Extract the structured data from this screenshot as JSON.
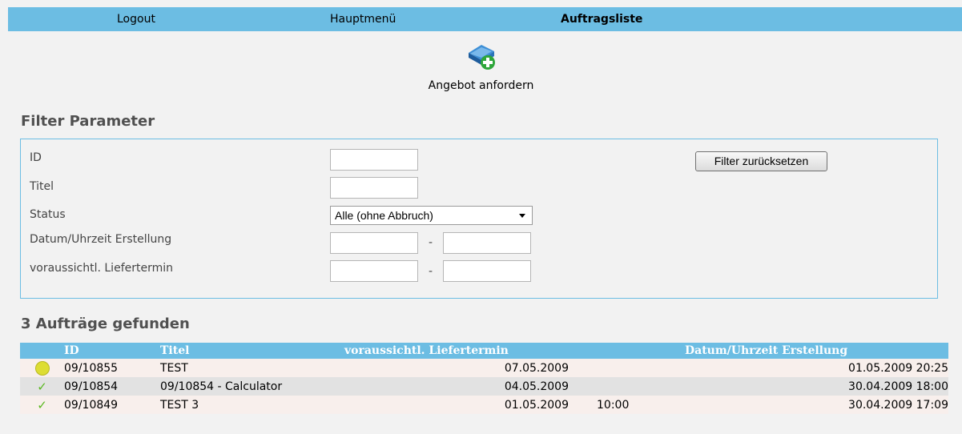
{
  "nav": {
    "logout": "Logout",
    "main_menu": "Hauptmenü",
    "order_list": "Auftragsliste"
  },
  "offer": {
    "label": "Angebot anfordern",
    "icon": "book-add-icon"
  },
  "filter": {
    "heading": "Filter Parameter",
    "labels": {
      "id": "ID",
      "title": "Titel",
      "status": "Status",
      "created": "Datum/Uhrzeit Erstellung",
      "delivery": "voraussichtl. Liefertermin"
    },
    "status_selected": "Alle (ohne Abbruch)",
    "range_separator": "-",
    "reset_button": "Filter zurücksetzen"
  },
  "results": {
    "heading": "3 Aufträge gefunden",
    "columns": {
      "id": "ID",
      "title": "Titel",
      "delivery": "voraussichtl. Liefertermin",
      "created": "Datum/Uhrzeit Erstellung"
    },
    "rows": [
      {
        "status_icon": "yellow-dot-icon",
        "id": "09/10855",
        "title": "TEST",
        "delivery_date": "07.05.2009",
        "delivery_time": "",
        "created": "01.05.2009 20:25"
      },
      {
        "status_icon": "check-icon",
        "id": "09/10854",
        "title": "09/10854 - Calculator",
        "delivery_date": "04.05.2009",
        "delivery_time": "",
        "created": "30.04.2009 18:00"
      },
      {
        "status_icon": "check-icon",
        "id": "09/10849",
        "title": "TEST 3",
        "delivery_date": "01.05.2009",
        "delivery_time": "10:00",
        "created": "30.04.2009 17:09"
      }
    ]
  },
  "colors": {
    "accent": "#6cbde3",
    "row_light": "#f8efec",
    "row_gray": "#e2e2e2",
    "status_yellow": "#dddd33",
    "check_green": "#5ab820"
  }
}
